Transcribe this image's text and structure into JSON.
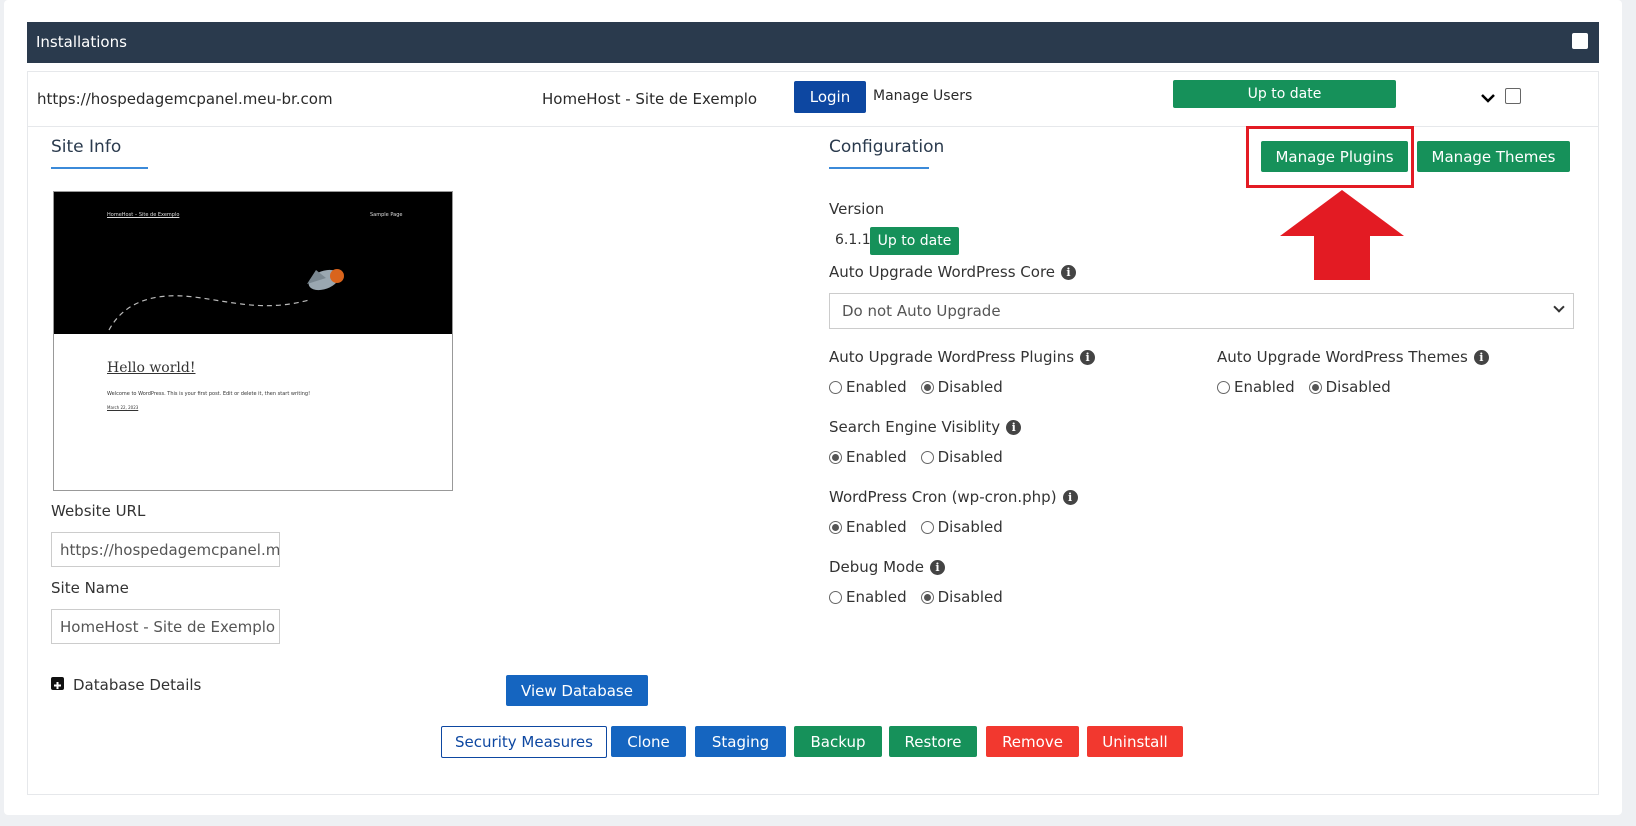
{
  "header": {
    "title": "Installations"
  },
  "install": {
    "url": "https://hospedagemcpanel.meu-br.com",
    "site_title": "HomeHost - Site de Exemplo",
    "login_label": "Login",
    "manage_users_label": "Manage Users",
    "status_label": "Up to date"
  },
  "site_info": {
    "title": "Site Info",
    "preview": {
      "site_name": "HomeHost – Site de Exemplo",
      "nav_link": "Sample Page",
      "post_title": "Hello world!",
      "post_text": "Welcome to WordPress. This is your first post. Edit or delete it, then start writing!",
      "post_date": "March 22, 2023"
    },
    "website_url_label": "Website URL",
    "website_url_value": "https://hospedagemcpanel.m",
    "site_name_label": "Site Name",
    "site_name_value": "HomeHost - Site de Exemplo",
    "db_details_label": "Database Details",
    "view_db_label": "View Database"
  },
  "config": {
    "title": "Configuration",
    "manage_plugins_label": "Manage Plugins",
    "manage_themes_label": "Manage Themes",
    "version_label": "Version",
    "version_value": "6.1.1",
    "version_status": "Up to date",
    "auto_core_label": "Auto Upgrade WordPress Core",
    "auto_core_value": "Do not Auto Upgrade",
    "auto_plugins_label": "Auto Upgrade WordPress Plugins",
    "auto_themes_label": "Auto Upgrade WordPress Themes",
    "seo_label": "Search Engine Visiblity",
    "cron_label": "WordPress Cron (wp-cron.php)",
    "debug_label": "Debug Mode",
    "enabled_label": "Enabled",
    "disabled_label": "Disabled",
    "settings": {
      "auto_plugins": "Disabled",
      "auto_themes": "Disabled",
      "seo": "Enabled",
      "cron": "Enabled",
      "debug": "Disabled"
    }
  },
  "actions": {
    "security": "Security Measures",
    "clone": "Clone",
    "staging": "Staging",
    "backup": "Backup",
    "restore": "Restore",
    "remove": "Remove",
    "uninstall": "Uninstall"
  },
  "colors": {
    "header_bg": "#2a3a4d",
    "primary": "#1565c0",
    "success": "#16915a",
    "danger": "#f2382f",
    "highlight": "#e31b23"
  }
}
